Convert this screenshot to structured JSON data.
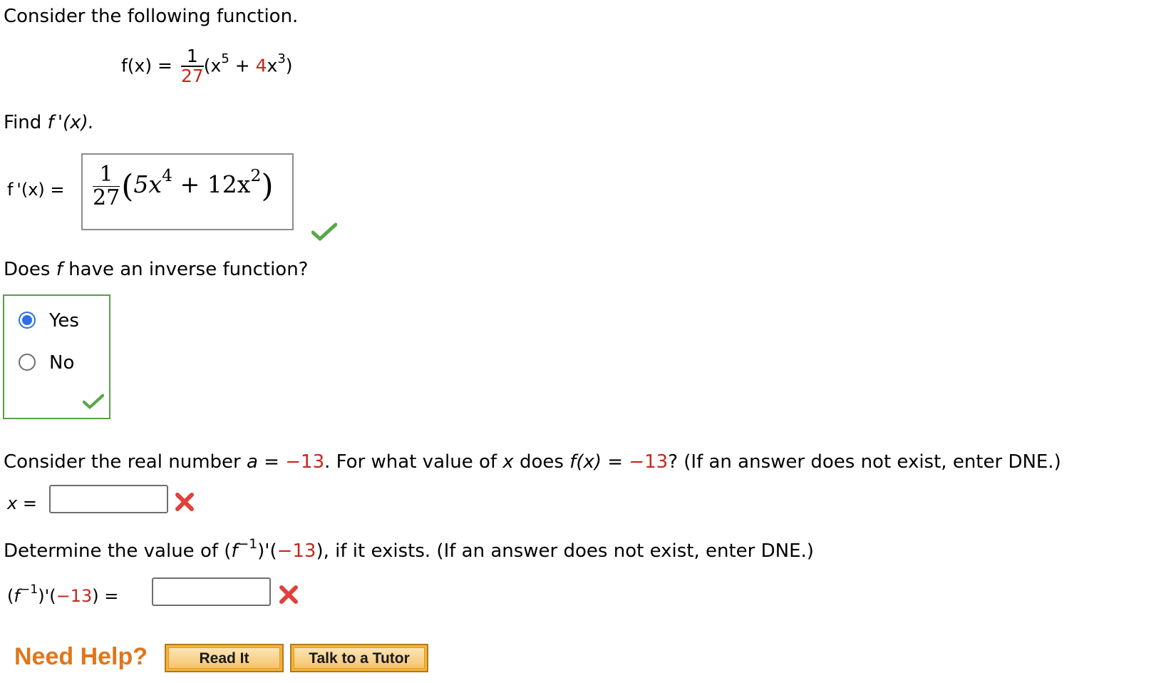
{
  "intro": "Consider the following function.",
  "function_def": {
    "lhs": "f(x) =",
    "numerator": "1",
    "denominator": "27",
    "open": "(x",
    "exp1": "5",
    "plus": " + ",
    "coef": "4",
    "var": "x",
    "exp2": "3",
    "close": ")"
  },
  "find_prompt": {
    "prefix": "Find ",
    "expr": "f '(x).",
    "suffix": ""
  },
  "derivative": {
    "label": "f '(x) =",
    "answer_numerator": "1",
    "answer_denominator": "27",
    "answer_body_a": "5x",
    "answer_exp_a": "4",
    "answer_plus": " + 12x",
    "answer_exp_b": "2"
  },
  "inverse_question": {
    "prefix": "Does ",
    "f": "f",
    "suffix": " have an inverse function?",
    "options": [
      {
        "label": "Yes",
        "selected": true
      },
      {
        "label": "No",
        "selected": false
      }
    ]
  },
  "real_number_question": {
    "part1": "Consider the real number ",
    "a": "a",
    "eq": " = ",
    "value": "−13",
    "part2": ".  For what value of ",
    "x": "x",
    "part3": " does ",
    "fx": "f(x)",
    "eq2": " = ",
    "value2": "−13",
    "part4": "?  (If an answer does not exist, enter DNE.)",
    "input_label": "x =",
    "input_value": ""
  },
  "inverse_derivative_question": {
    "part1": "Determine the value of  (",
    "f": "f",
    "exp": "−1",
    "part2": ")'(",
    "value": "−13",
    "part3": "),  if it exists. (If an answer does not exist, enter DNE.)",
    "label_open": "(",
    "label_f": "f",
    "label_exp": "−1",
    "label_mid": ")'(",
    "label_value": "−13",
    "label_close": ") =",
    "input_value": ""
  },
  "help": {
    "title": "Need Help?",
    "read_it": "Read It",
    "talk_to_tutor": "Talk to a Tutor"
  },
  "colors": {
    "red_value": "#c7281c",
    "correct_green": "#5aa64a",
    "incorrect_red": "#e0413a",
    "radio_blue": "#2c6fe6",
    "help_orange": "#e0761c"
  }
}
